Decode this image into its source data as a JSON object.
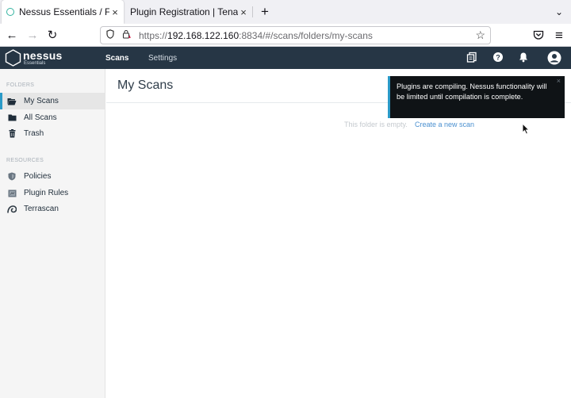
{
  "browser": {
    "tabs": [
      {
        "title": "Nessus Essentials / Folder",
        "close": "×"
      },
      {
        "title": "Plugin Registration | Tenable®",
        "close": "×"
      }
    ],
    "new_tab": "+",
    "tab_list": "⌄",
    "nav": {
      "back": "←",
      "forward": "→",
      "reload": "↻",
      "menu": "≡"
    },
    "url": {
      "scheme": "https://",
      "host": "192.168.122.160",
      "rest": ":8834/#/scans/folders/my-scans"
    },
    "bookmark_star": "☆"
  },
  "header": {
    "logo": "nessus",
    "logo_sub": "Essentials",
    "nav": [
      {
        "label": "Scans"
      },
      {
        "label": "Settings"
      }
    ],
    "icons": [
      "scan-history-icon",
      "help-icon",
      "notifications-icon",
      "user-icon"
    ]
  },
  "sidebar": {
    "folders_label": "FOLDERS",
    "folders": [
      {
        "label": "My Scans",
        "icon": "folder-open-icon"
      },
      {
        "label": "All Scans",
        "icon": "folder-icon"
      },
      {
        "label": "Trash",
        "icon": "trash-icon"
      }
    ],
    "resources_label": "RESOURCES",
    "resources": [
      {
        "label": "Policies",
        "icon": "shield-icon"
      },
      {
        "label": "Plugin Rules",
        "icon": "plugin-rules-icon"
      },
      {
        "label": "Terrascan",
        "icon": "terrascan-icon"
      }
    ]
  },
  "main": {
    "title": "My Scans",
    "empty_text": "This folder is empty.",
    "empty_link": "Create a new scan"
  },
  "toast": {
    "message": "Plugins are compiling. Nessus functionality will be limited until compilation is complete.",
    "close": "×"
  },
  "colors": {
    "header_bg": "#263645",
    "accent": "#2a9ac8",
    "link": "#4a90d0",
    "toast_bg": "#0f1316"
  }
}
